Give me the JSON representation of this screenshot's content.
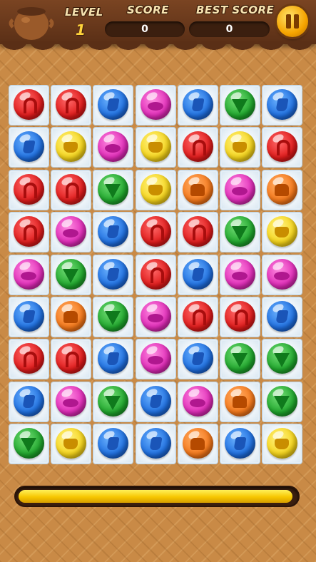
{
  "hud": {
    "level_label": "LEVEL",
    "level_value": "1",
    "score_label": "SCORE",
    "score_value": "0",
    "best_label": "BEST SCORE",
    "best_value": "0",
    "pause_icon": "pause-icon",
    "pot_icon": "chocolate-pot-icon"
  },
  "board": {
    "columns": 7,
    "rows": 9,
    "grid": [
      [
        "red",
        "red",
        "blue",
        "pink",
        "blue",
        "green",
        "blue"
      ],
      [
        "blue",
        "yellow",
        "pink",
        "yellow",
        "red",
        "yellow",
        "red"
      ],
      [
        "red",
        "red",
        "green",
        "yellow",
        "orange",
        "pink",
        "orange"
      ],
      [
        "red",
        "pink",
        "blue",
        "red",
        "red",
        "green",
        "yellow"
      ],
      [
        "pink",
        "green",
        "blue",
        "red",
        "blue",
        "pink",
        "pink"
      ],
      [
        "blue",
        "orange",
        "green",
        "pink",
        "red",
        "red",
        "blue"
      ],
      [
        "red",
        "red",
        "blue",
        "pink",
        "blue",
        "green",
        "green"
      ],
      [
        "blue",
        "pink",
        "green",
        "blue",
        "pink",
        "orange",
        "green"
      ],
      [
        "green",
        "yellow",
        "blue",
        "blue",
        "orange",
        "blue",
        "yellow"
      ]
    ],
    "candy_icons": {
      "red": "candy-cane-icon",
      "blue": "blue-candy-icon",
      "pink": "pink-candy-icon",
      "green": "green-gem-icon",
      "yellow": "honey-pot-icon",
      "orange": "orange-cupcake-icon"
    }
  },
  "timer": {
    "progress": 0.99,
    "color": "#f7c600"
  },
  "colors": {
    "header": "#6b3a1b",
    "background": "#c98a46",
    "tile": "#eaf2f8"
  }
}
